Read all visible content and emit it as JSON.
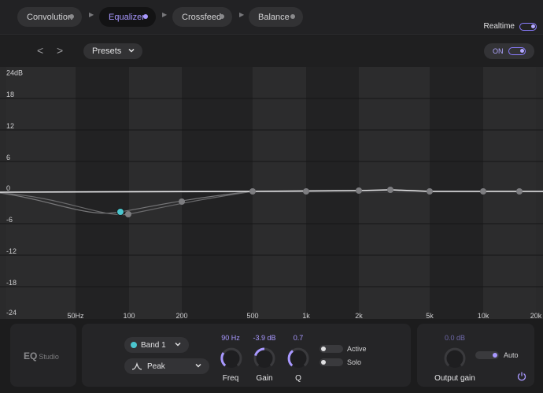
{
  "pipeline": {
    "stages": [
      {
        "label": "Convolution"
      },
      {
        "label": "Equalizer"
      },
      {
        "label": "Crossfeed"
      },
      {
        "label": "Balance"
      }
    ],
    "active_stage": "Equalizer",
    "realtime_label": "Realtime",
    "realtime_on": true
  },
  "toolbar": {
    "back_icon": "chevron-left-icon",
    "forward_icon": "chevron-right-icon",
    "presets_label": "Presets",
    "on_label": "ON",
    "eq_enabled": true
  },
  "plot": {
    "db_labels": [
      "24dB",
      "18",
      "12",
      "6",
      "0",
      "-6",
      "-12",
      "-18",
      "-24"
    ],
    "freq_labels": [
      "50Hz",
      "100",
      "200",
      "500",
      "1k",
      "2k",
      "5k",
      "10k",
      "20k"
    ],
    "grid": true,
    "curve_color": "#e8e8ea",
    "selected_band_color": "#4bc6cf"
  },
  "band": {
    "name": "Band 1",
    "color": "#4bc6cf",
    "filter_type": "Peak",
    "freq_value": "90 Hz",
    "freq_label": "Freq",
    "gain_value": "-3.9 dB",
    "gain_label": "Gain",
    "q_value": "0.7",
    "q_label": "Q",
    "active_label": "Active",
    "solo_label": "Solo"
  },
  "output": {
    "gain_value": "0.0 dB",
    "gain_label": "Output gain",
    "auto_label": "Auto",
    "auto_on": true,
    "power_icon": "power-icon"
  },
  "logo": {
    "brand": "EQ",
    "product": "Studio"
  },
  "colors": {
    "accent": "#a898ff",
    "band": "#4bc6cf",
    "background": "#1c1c1d"
  }
}
